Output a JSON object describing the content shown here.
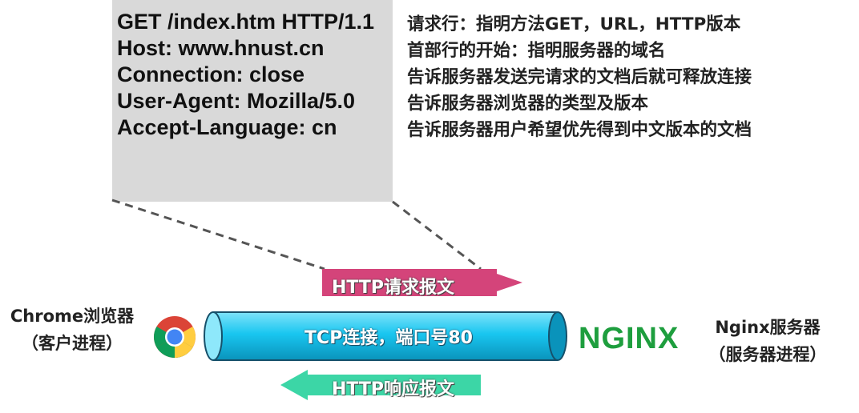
{
  "request_message": {
    "lines": [
      "GET /index.htm HTTP/1.1",
      "Host: www.hnust.cn",
      "Connection: close",
      "User-Agent:  Mozilla/5.0",
      "Accept-Language: cn"
    ],
    "descriptions": [
      "请求行：指明方法GET，URL，HTTP版本",
      "首部行的开始：指明服务器的域名",
      "告诉服务器发送完请求的文档后就可释放连接",
      "告诉服务器浏览器的类型及版本",
      "告诉服务器用户希望优先得到中文版本的文档"
    ]
  },
  "connection": {
    "tube_label": "TCP连接，端口号80",
    "request_arrow_label": "HTTP请求报文",
    "response_arrow_label": "HTTP响应报文"
  },
  "client": {
    "name": "Chrome浏览器",
    "role": "（客户进程）",
    "icon": "chrome-icon"
  },
  "server": {
    "logo_text": "NGINX",
    "name": "Nginx服务器",
    "role": "（服务器进程）"
  },
  "colors": {
    "box_bg": "#d9d9d9",
    "tube_fill": "#19c6f0",
    "request_arrow": "#d4447a",
    "response_arrow": "#3cd6a6",
    "nginx_green": "#1e9e3e"
  }
}
